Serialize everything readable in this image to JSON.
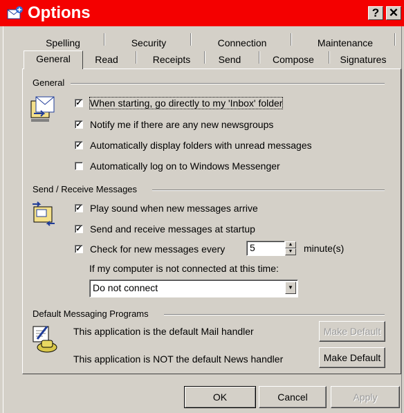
{
  "window": {
    "title": "Options",
    "help_glyph": "?",
    "close_glyph": "✕"
  },
  "tabs_row1": [
    {
      "label": "Spelling"
    },
    {
      "label": "Security"
    },
    {
      "label": "Connection"
    },
    {
      "label": "Maintenance"
    }
  ],
  "tabs_row2": [
    {
      "label": "General",
      "active": true
    },
    {
      "label": "Read"
    },
    {
      "label": "Receipts"
    },
    {
      "label": "Send"
    },
    {
      "label": "Compose"
    },
    {
      "label": "Signatures"
    }
  ],
  "general": {
    "heading": "General",
    "icon": "inbox-folder-icon",
    "options": [
      {
        "label": "When starting, go directly to my 'Inbox' folder",
        "checked": true
      },
      {
        "label": "Notify me if there are any new newsgroups",
        "checked": true
      },
      {
        "label": "Automatically display folders with unread messages",
        "checked": true
      },
      {
        "label": "Automatically log on to Windows Messenger",
        "checked": false
      }
    ]
  },
  "send_receive": {
    "heading": "Send / Receive Messages",
    "icon": "send-receive-icon",
    "options": [
      {
        "label": "Play sound when new messages arrive",
        "checked": true
      },
      {
        "label": "Send and receive messages at startup",
        "checked": true
      },
      {
        "label": "Check for new messages every",
        "checked": true
      }
    ],
    "interval_value": "5",
    "interval_unit": "minute(s)",
    "not_connected_label": "If my computer is not connected at this time:",
    "connect_select": "Do not connect"
  },
  "default_programs": {
    "heading": "Default Messaging Programs",
    "icon": "default-programs-icon",
    "mail_text": "This application is the default Mail handler",
    "mail_button": "Make Default",
    "news_text": "This application is NOT the default News handler",
    "news_button": "Make Default"
  },
  "footer": {
    "ok": "OK",
    "cancel": "Cancel",
    "apply": "Apply"
  }
}
